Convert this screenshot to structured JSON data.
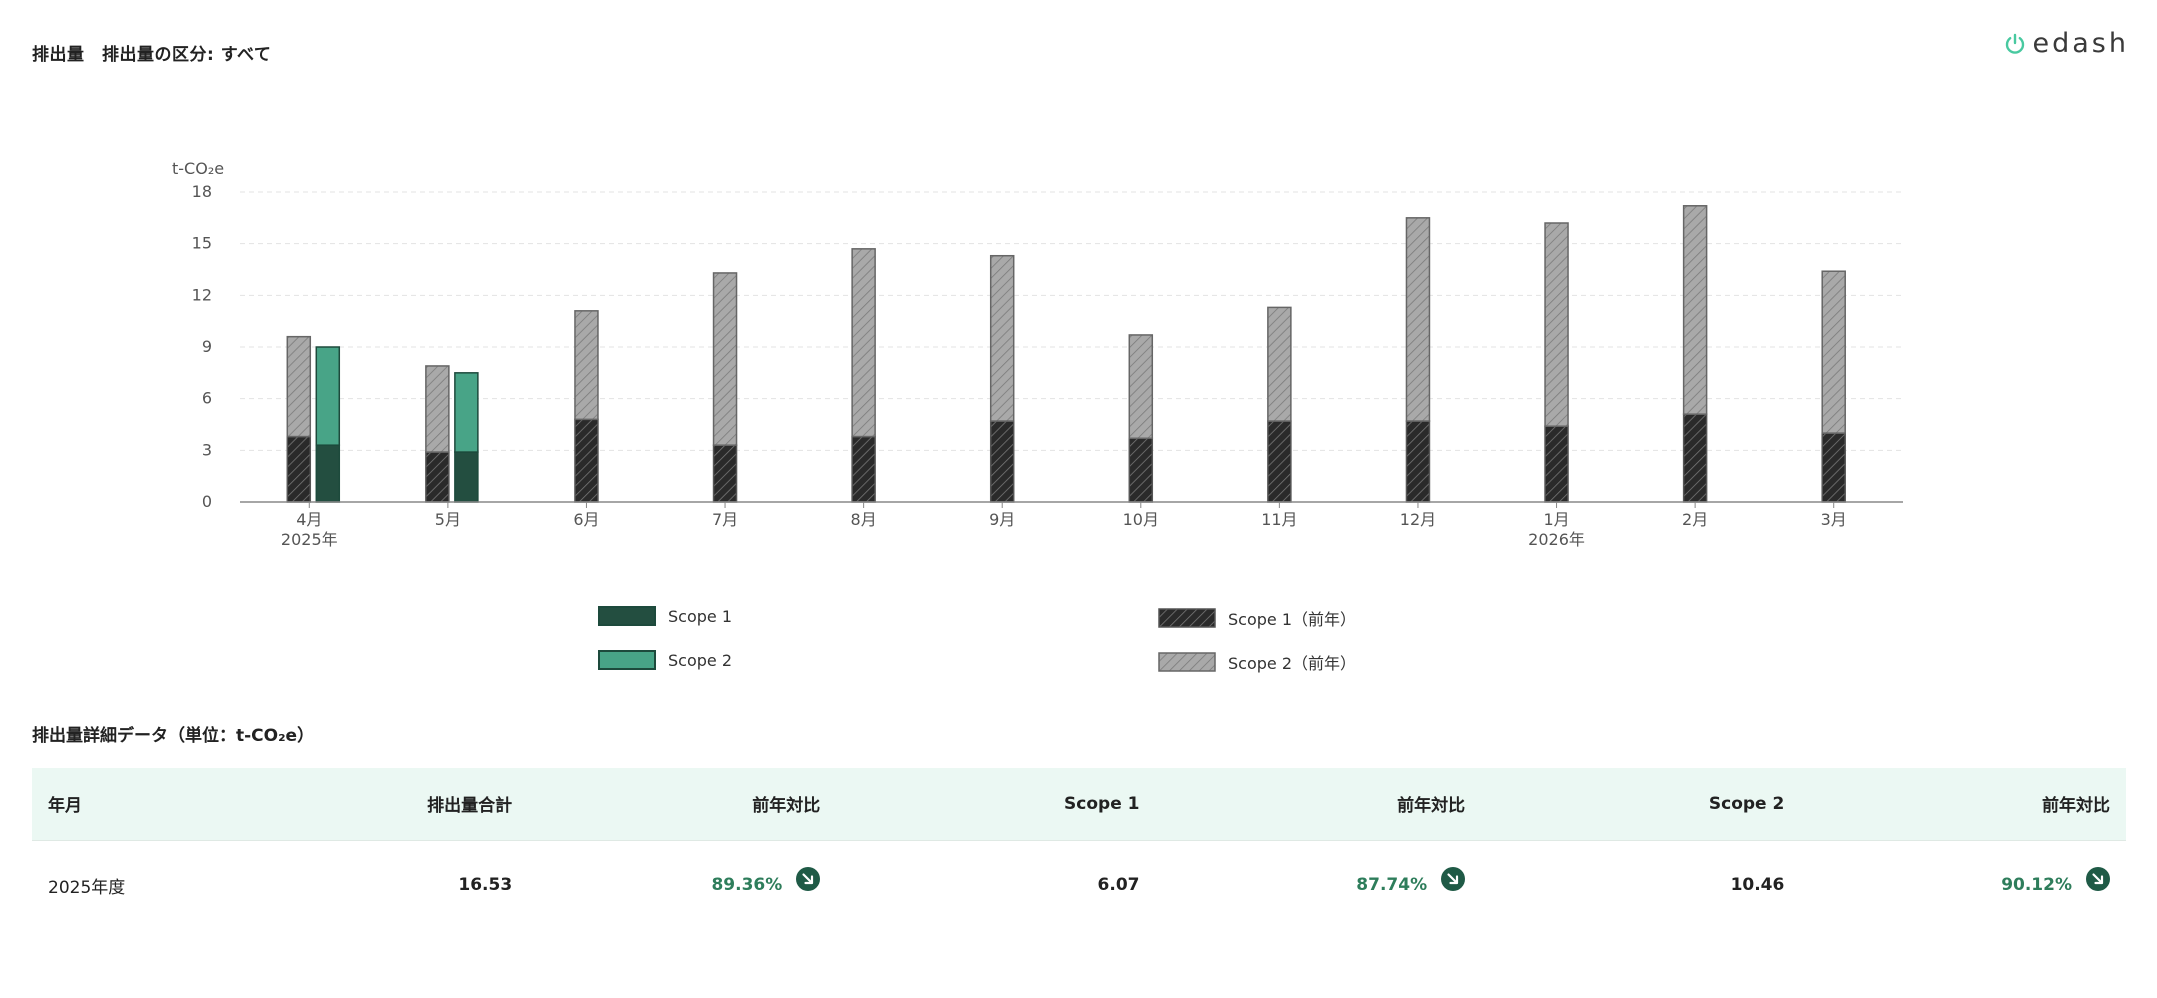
{
  "header": {
    "title": "排出量　排出量の区分: すべて",
    "logo_text": "edash"
  },
  "colors": {
    "scope1": "#234e40",
    "scope2": "#48a487",
    "scope2_stroke": "#1d4a3c",
    "prev_scope1_fill": "#2a2a2a",
    "prev_scope2_fill": "#aaaaaa",
    "accent_green": "#2e7d5b",
    "table_header_bg": "#ebf8f3"
  },
  "chart_data": {
    "type": "bar",
    "stacked": true,
    "ylabel": "t-CO₂e",
    "ylim": [
      0,
      18
    ],
    "yticks": [
      0,
      3,
      6,
      9,
      12,
      15,
      18
    ],
    "grid": true,
    "categories": [
      "4月",
      "5月",
      "6月",
      "7月",
      "8月",
      "9月",
      "10月",
      "11月",
      "12月",
      "1月",
      "2月",
      "3月"
    ],
    "year_labels": [
      "2025年",
      "",
      "",
      "",
      "",
      "",
      "",
      "",
      "",
      "2026年",
      "",
      ""
    ],
    "series": [
      {
        "name": "Scope 1",
        "stack": "current",
        "values": [
          3.3,
          2.9,
          null,
          null,
          null,
          null,
          null,
          null,
          null,
          null,
          null,
          null
        ]
      },
      {
        "name": "Scope 2",
        "stack": "current",
        "values": [
          5.7,
          4.6,
          null,
          null,
          null,
          null,
          null,
          null,
          null,
          null,
          null,
          null
        ]
      },
      {
        "name": "Scope 1（前年）",
        "stack": "previous",
        "values": [
          3.8,
          2.9,
          4.8,
          3.3,
          3.8,
          4.7,
          3.7,
          4.7,
          4.7,
          4.4,
          5.1,
          4.0
        ]
      },
      {
        "name": "Scope 2（前年）",
        "stack": "previous",
        "values": [
          5.8,
          5.0,
          6.3,
          10.0,
          10.9,
          9.6,
          6.0,
          6.6,
          11.8,
          11.8,
          12.1,
          9.4
        ]
      }
    ],
    "legend_placement": "bottom"
  },
  "legend": {
    "items": [
      {
        "label": "Scope 1"
      },
      {
        "label": "Scope 2"
      },
      {
        "label": "Scope 1（前年）"
      },
      {
        "label": "Scope 2（前年）"
      }
    ]
  },
  "table": {
    "title": "排出量詳細データ（単位：t-CO₂e）",
    "headers": [
      "年月",
      "排出量合計",
      "前年対比",
      "Scope 1",
      "前年対比",
      "Scope 2",
      "前年対比"
    ],
    "rows": [
      {
        "period": "2025年度",
        "total": "16.53",
        "total_ratio": "89.36%",
        "scope1": "6.07",
        "scope1_ratio": "87.74%",
        "scope2": "10.46",
        "scope2_ratio": "90.12%"
      }
    ],
    "trend_icon": "arrow-down-right-icon"
  }
}
